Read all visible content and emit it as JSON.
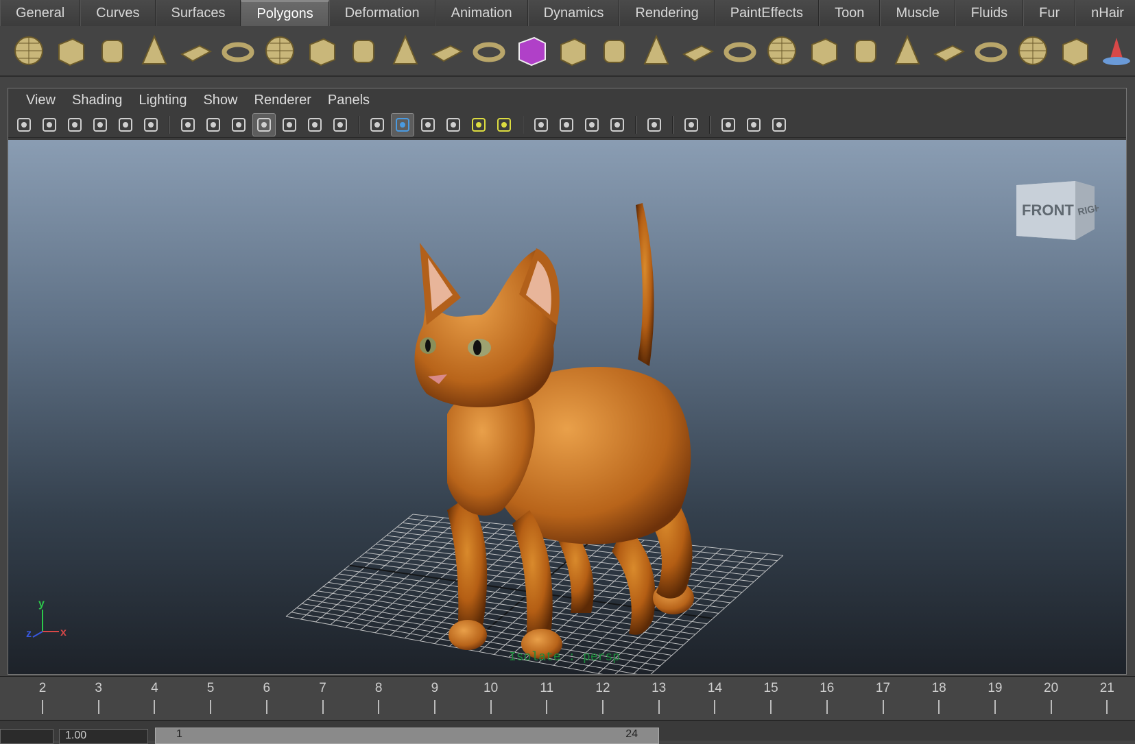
{
  "shelf": {
    "tabs": [
      {
        "label": "General",
        "active": false
      },
      {
        "label": "Curves",
        "active": false
      },
      {
        "label": "Surfaces",
        "active": false
      },
      {
        "label": "Polygons",
        "active": true
      },
      {
        "label": "Deformation",
        "active": false
      },
      {
        "label": "Animation",
        "active": false
      },
      {
        "label": "Dynamics",
        "active": false
      },
      {
        "label": "Rendering",
        "active": false
      },
      {
        "label": "PaintEffects",
        "active": false
      },
      {
        "label": "Toon",
        "active": false
      },
      {
        "label": "Muscle",
        "active": false
      },
      {
        "label": "Fluids",
        "active": false
      },
      {
        "label": "Fur",
        "active": false
      },
      {
        "label": "nHair",
        "active": false
      }
    ],
    "icons": [
      "poly-sphere-icon",
      "poly-cube-icon",
      "poly-cylinder-icon",
      "poly-cone-icon",
      "poly-plane-icon",
      "poly-torus-icon",
      "poly-pyramid-icon",
      "poly-pipe-icon",
      "poly-helix-icon",
      "separate-icon",
      "combine-icon",
      "extract-icon",
      "smooth-icon",
      "bevel-icon",
      "extrude-icon",
      "bridge-icon",
      "append-polygon-icon",
      "split-polygon-icon",
      "insert-edge-loop-icon",
      "offset-edge-loop-icon",
      "poke-face-icon",
      "wedge-face-icon",
      "collapse-icon",
      "merge-vertices-icon",
      "flip-triangle-icon",
      "spin-edge-icon",
      "sculpt-icon"
    ]
  },
  "panel": {
    "menus": [
      "View",
      "Shading",
      "Lighting",
      "Show",
      "Renderer",
      "Panels"
    ],
    "toolbar": [
      "select-camera-icon",
      "camera-attributes-icon",
      "bookmarks-icon",
      "image-plane-icon",
      "two-d-pan-icon",
      "grease-pencil-icon",
      "grid-icon",
      "film-gate-icon",
      "resolution-gate-icon",
      "gate-mask-icon",
      "field-chart-icon",
      "safe-action-icon",
      "safe-title-icon",
      "wireframe-icon",
      "smooth-shade-icon",
      "wireframe-on-shaded-icon",
      "textured-icon",
      "use-all-lights-icon",
      "shadows-icon",
      "screen-ambient-occlusion-icon",
      "motion-blur-icon",
      "anti-aliasing-icon",
      "depth-of-field-icon",
      "hud-icon",
      "isolate-select-icon",
      "xray-icon",
      "xray-joints-icon",
      "backface-culling-icon"
    ]
  },
  "viewport": {
    "view_cube": {
      "front": "FRONT",
      "right": "RIGHT"
    },
    "axis": {
      "x": "x",
      "y": "y",
      "z": "z"
    },
    "model_label": "Isolate : persp"
  },
  "timeline": {
    "ticks": [
      "2",
      "3",
      "4",
      "5",
      "6",
      "7",
      "8",
      "9",
      "10",
      "11",
      "12",
      "13",
      "14",
      "15",
      "16",
      "17",
      "18",
      "19",
      "20",
      "21"
    ]
  },
  "range": {
    "start": "",
    "current": "1.00",
    "slider_start": "1",
    "slider_end": "24"
  }
}
